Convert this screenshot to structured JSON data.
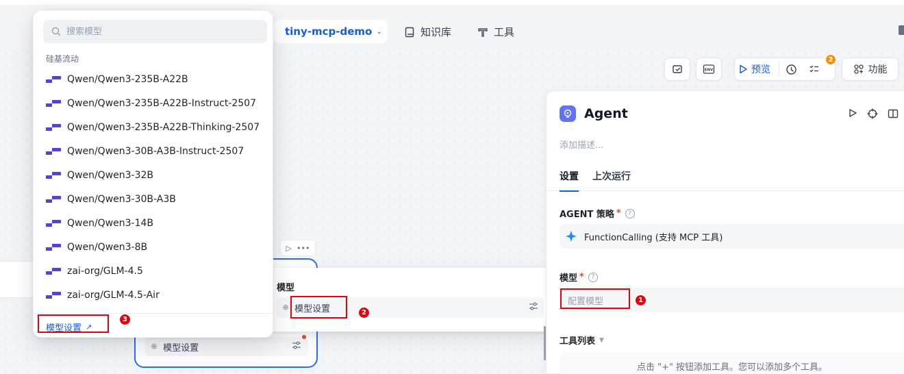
{
  "topbar": {
    "app_name": "tiny-mcp-demo",
    "nav_knowledge": "知识库",
    "nav_tools": "工具"
  },
  "toolbar": {
    "preview_label": "预览",
    "badge_count": "2",
    "features_label": "功能"
  },
  "canvas": {
    "agent_node": {
      "model_label": "模型设置"
    }
  },
  "model_popup": {
    "title": "模型",
    "model_setting": "模型设置"
  },
  "right_panel": {
    "title": "Agent",
    "description_placeholder": "添加描述...",
    "tabs": [
      "设置",
      "上次运行"
    ],
    "strategy_label": "AGENT 策略",
    "strategy_value": "FunctionCalling (支持 MCP 工具)",
    "model_label": "模型",
    "model_placeholder": "配置模型",
    "tools_label": "工具列表",
    "tools_hint": "点击 \"+\" 按钮添加工具。您可以添加多个工具。"
  },
  "dropdown": {
    "search_placeholder": "搜索模型",
    "group": "硅基流动",
    "items": [
      "Qwen/Qwen3-235B-A22B",
      "Qwen/Qwen3-235B-A22B-Instruct-2507",
      "Qwen/Qwen3-235B-A22B-Thinking-2507",
      "Qwen/Qwen3-30B-A3B-Instruct-2507",
      "Qwen/Qwen3-32B",
      "Qwen/Qwen3-30B-A3B",
      "Qwen/Qwen3-14B",
      "Qwen/Qwen3-8B",
      "zai-org/GLM-4.5",
      "zai-org/GLM-4.5-Air"
    ],
    "footer_link": "模型设置"
  },
  "annotations": [
    "1",
    "2",
    "3"
  ],
  "colors": {
    "accent": "#155aef",
    "annotation_red": "#e8000d",
    "badge_orange": "#f79009",
    "provider_logo": "#5b3fd9"
  }
}
